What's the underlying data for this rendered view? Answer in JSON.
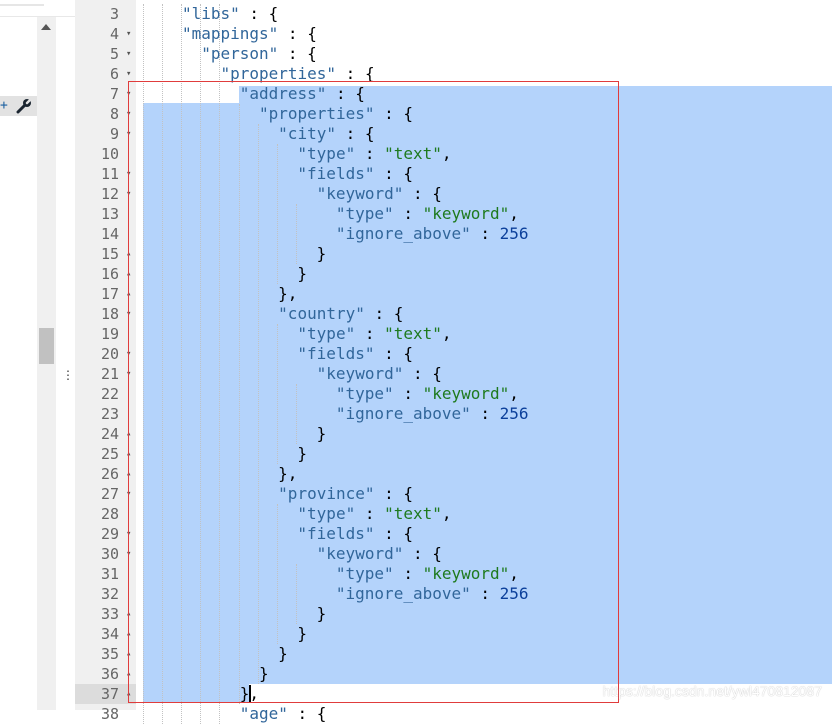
{
  "gutter_lines": [
    {
      "ln": "3",
      "fold": ""
    },
    {
      "ln": "4",
      "fold": "▾"
    },
    {
      "ln": "5",
      "fold": "▾"
    },
    {
      "ln": "6",
      "fold": "▾"
    },
    {
      "ln": "7",
      "fold": "▾"
    },
    {
      "ln": "8",
      "fold": "▾"
    },
    {
      "ln": "9",
      "fold": "▾"
    },
    {
      "ln": "10",
      "fold": ""
    },
    {
      "ln": "11",
      "fold": "▾"
    },
    {
      "ln": "12",
      "fold": "▾"
    },
    {
      "ln": "13",
      "fold": ""
    },
    {
      "ln": "14",
      "fold": ""
    },
    {
      "ln": "15",
      "fold": "▴"
    },
    {
      "ln": "16",
      "fold": "▴"
    },
    {
      "ln": "17",
      "fold": "▴"
    },
    {
      "ln": "18",
      "fold": "▾"
    },
    {
      "ln": "19",
      "fold": ""
    },
    {
      "ln": "20",
      "fold": "▾"
    },
    {
      "ln": "21",
      "fold": "▾"
    },
    {
      "ln": "22",
      "fold": ""
    },
    {
      "ln": "23",
      "fold": ""
    },
    {
      "ln": "24",
      "fold": "▴"
    },
    {
      "ln": "25",
      "fold": "▴"
    },
    {
      "ln": "26",
      "fold": "▴"
    },
    {
      "ln": "27",
      "fold": "▾"
    },
    {
      "ln": "28",
      "fold": ""
    },
    {
      "ln": "29",
      "fold": "▾"
    },
    {
      "ln": "30",
      "fold": "▾"
    },
    {
      "ln": "31",
      "fold": ""
    },
    {
      "ln": "32",
      "fold": ""
    },
    {
      "ln": "33",
      "fold": "▴"
    },
    {
      "ln": "34",
      "fold": "▴"
    },
    {
      "ln": "35",
      "fold": "▴"
    },
    {
      "ln": "36",
      "fold": "▴"
    },
    {
      "ln": "37",
      "fold": "▴"
    },
    {
      "ln": "38",
      "fold": ""
    }
  ],
  "active_line": "37",
  "code_lines": [
    {
      "indent": 2,
      "tokens": [
        {
          "t": "\"libs\"",
          "c": "k"
        },
        {
          "t": " : {",
          "c": "p"
        }
      ]
    },
    {
      "indent": 2,
      "tokens": [
        {
          "t": "\"mappings\"",
          "c": "k"
        },
        {
          "t": " : {",
          "c": "p"
        }
      ]
    },
    {
      "indent": 3,
      "tokens": [
        {
          "t": "\"person\"",
          "c": "k"
        },
        {
          "t": " : {",
          "c": "p"
        }
      ]
    },
    {
      "indent": 4,
      "tokens": [
        {
          "t": "\"properties\"",
          "c": "k"
        },
        {
          "t": " : {",
          "c": "p"
        }
      ]
    },
    {
      "indent": 5,
      "tokens": [
        {
          "t": "\"address\"",
          "c": "k"
        },
        {
          "t": " : {",
          "c": "p"
        }
      ]
    },
    {
      "indent": 6,
      "tokens": [
        {
          "t": "\"properties\"",
          "c": "k"
        },
        {
          "t": " : {",
          "c": "p"
        }
      ]
    },
    {
      "indent": 7,
      "tokens": [
        {
          "t": "\"city\"",
          "c": "k"
        },
        {
          "t": " : {",
          "c": "p"
        }
      ]
    },
    {
      "indent": 8,
      "tokens": [
        {
          "t": "\"type\"",
          "c": "k"
        },
        {
          "t": " : ",
          "c": "p"
        },
        {
          "t": "\"text\"",
          "c": "s"
        },
        {
          "t": ",",
          "c": "p"
        }
      ]
    },
    {
      "indent": 8,
      "tokens": [
        {
          "t": "\"fields\"",
          "c": "k"
        },
        {
          "t": " : {",
          "c": "p"
        }
      ]
    },
    {
      "indent": 9,
      "tokens": [
        {
          "t": "\"keyword\"",
          "c": "k"
        },
        {
          "t": " : {",
          "c": "p"
        }
      ]
    },
    {
      "indent": 10,
      "tokens": [
        {
          "t": "\"type\"",
          "c": "k"
        },
        {
          "t": " : ",
          "c": "p"
        },
        {
          "t": "\"keyword\"",
          "c": "s"
        },
        {
          "t": ",",
          "c": "p"
        }
      ]
    },
    {
      "indent": 10,
      "tokens": [
        {
          "t": "\"ignore_above\"",
          "c": "k"
        },
        {
          "t": " : ",
          "c": "p"
        },
        {
          "t": "256",
          "c": "n"
        }
      ]
    },
    {
      "indent": 9,
      "tokens": [
        {
          "t": "}",
          "c": "p"
        }
      ]
    },
    {
      "indent": 8,
      "tokens": [
        {
          "t": "}",
          "c": "p"
        }
      ]
    },
    {
      "indent": 7,
      "tokens": [
        {
          "t": "},",
          "c": "p"
        }
      ]
    },
    {
      "indent": 7,
      "tokens": [
        {
          "t": "\"country\"",
          "c": "k"
        },
        {
          "t": " : {",
          "c": "p"
        }
      ]
    },
    {
      "indent": 8,
      "tokens": [
        {
          "t": "\"type\"",
          "c": "k"
        },
        {
          "t": " : ",
          "c": "p"
        },
        {
          "t": "\"text\"",
          "c": "s"
        },
        {
          "t": ",",
          "c": "p"
        }
      ]
    },
    {
      "indent": 8,
      "tokens": [
        {
          "t": "\"fields\"",
          "c": "k"
        },
        {
          "t": " : {",
          "c": "p"
        }
      ]
    },
    {
      "indent": 9,
      "tokens": [
        {
          "t": "\"keyword\"",
          "c": "k"
        },
        {
          "t": " : {",
          "c": "p"
        }
      ]
    },
    {
      "indent": 10,
      "tokens": [
        {
          "t": "\"type\"",
          "c": "k"
        },
        {
          "t": " : ",
          "c": "p"
        },
        {
          "t": "\"keyword\"",
          "c": "s"
        },
        {
          "t": ",",
          "c": "p"
        }
      ]
    },
    {
      "indent": 10,
      "tokens": [
        {
          "t": "\"ignore_above\"",
          "c": "k"
        },
        {
          "t": " : ",
          "c": "p"
        },
        {
          "t": "256",
          "c": "n"
        }
      ]
    },
    {
      "indent": 9,
      "tokens": [
        {
          "t": "}",
          "c": "p"
        }
      ]
    },
    {
      "indent": 8,
      "tokens": [
        {
          "t": "}",
          "c": "p"
        }
      ]
    },
    {
      "indent": 7,
      "tokens": [
        {
          "t": "},",
          "c": "p"
        }
      ]
    },
    {
      "indent": 7,
      "tokens": [
        {
          "t": "\"province\"",
          "c": "k"
        },
        {
          "t": " : {",
          "c": "p"
        }
      ]
    },
    {
      "indent": 8,
      "tokens": [
        {
          "t": "\"type\"",
          "c": "k"
        },
        {
          "t": " : ",
          "c": "p"
        },
        {
          "t": "\"text\"",
          "c": "s"
        },
        {
          "t": ",",
          "c": "p"
        }
      ]
    },
    {
      "indent": 8,
      "tokens": [
        {
          "t": "\"fields\"",
          "c": "k"
        },
        {
          "t": " : {",
          "c": "p"
        }
      ]
    },
    {
      "indent": 9,
      "tokens": [
        {
          "t": "\"keyword\"",
          "c": "k"
        },
        {
          "t": " : {",
          "c": "p"
        }
      ]
    },
    {
      "indent": 10,
      "tokens": [
        {
          "t": "\"type\"",
          "c": "k"
        },
        {
          "t": " : ",
          "c": "p"
        },
        {
          "t": "\"keyword\"",
          "c": "s"
        },
        {
          "t": ",",
          "c": "p"
        }
      ]
    },
    {
      "indent": 10,
      "tokens": [
        {
          "t": "\"ignore_above\"",
          "c": "k"
        },
        {
          "t": " : ",
          "c": "p"
        },
        {
          "t": "256",
          "c": "n"
        }
      ]
    },
    {
      "indent": 9,
      "tokens": [
        {
          "t": "}",
          "c": "p"
        }
      ]
    },
    {
      "indent": 8,
      "tokens": [
        {
          "t": "}",
          "c": "p"
        }
      ]
    },
    {
      "indent": 7,
      "tokens": [
        {
          "t": "}",
          "c": "p"
        }
      ]
    },
    {
      "indent": 6,
      "tokens": [
        {
          "t": "}",
          "c": "p"
        }
      ]
    },
    {
      "indent": 5,
      "tokens": [
        {
          "t": "},",
          "c": "p"
        }
      ]
    },
    {
      "indent": 5,
      "tokens": [
        {
          "t": "\"age\"",
          "c": "k"
        },
        {
          "t": " : {",
          "c": "p"
        }
      ]
    }
  ],
  "toolbar": {
    "wrench_icon": "wrench-icon",
    "expand_icon": "plus-icon"
  },
  "splitter": {
    "glyph": "⋮"
  },
  "colors": {
    "selection": "#b4d3fb",
    "highlight_box": "#e03c3c",
    "key": "#31669a",
    "string": "#1e7a1e",
    "number": "#0b3f9a"
  },
  "watermark": "https://blog.csdn.net/ywl470812087"
}
